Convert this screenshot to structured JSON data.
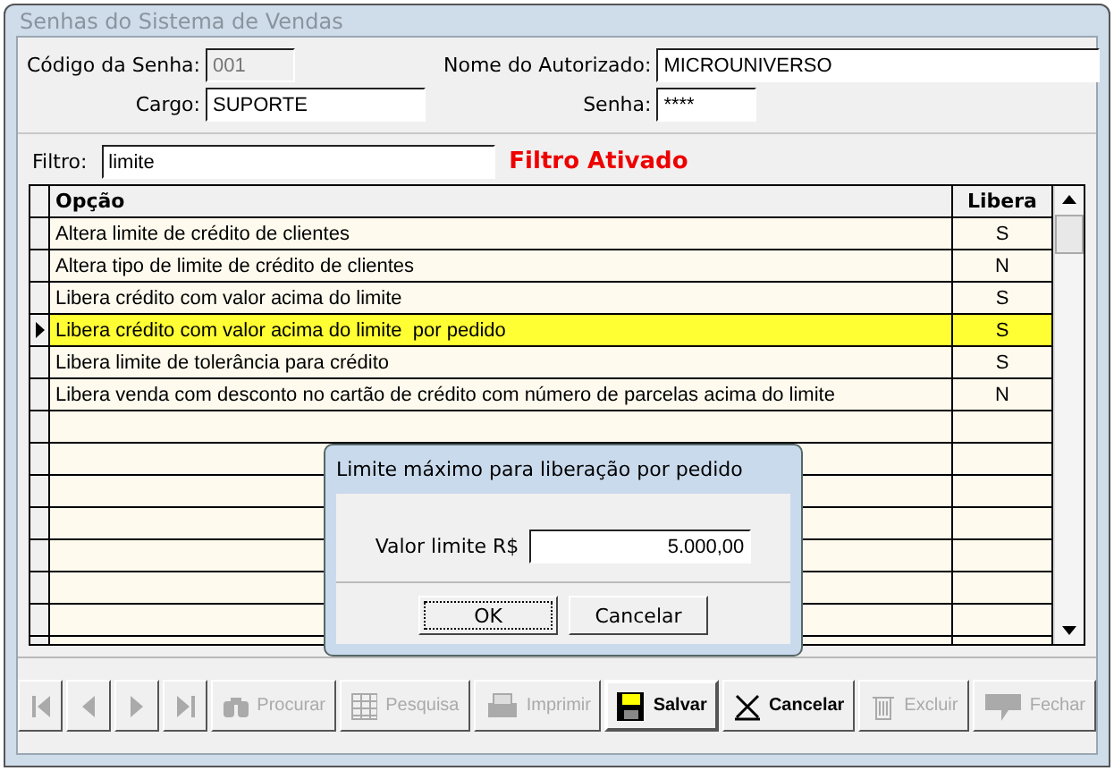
{
  "window": {
    "title": "Senhas do Sistema de Vendas"
  },
  "form": {
    "codigo": {
      "label": "Código da Senha:",
      "value": "001",
      "disabled": true
    },
    "nome": {
      "label": "Nome do Autorizado:",
      "value": "MICROUNIVERSO"
    },
    "cargo": {
      "label": "Cargo:",
      "value": "SUPORTE"
    },
    "senha": {
      "label": "Senha:",
      "value": "****"
    }
  },
  "filter": {
    "label": "Filtro:",
    "value": "limite",
    "status": "Filtro Ativado"
  },
  "table": {
    "columns": [
      "Opção",
      "Libera"
    ],
    "rows": [
      {
        "opcao": "Altera limite de crédito de clientes",
        "libera": "S",
        "selected": false
      },
      {
        "opcao": "Altera tipo de limite de crédito de clientes",
        "libera": "N",
        "selected": false
      },
      {
        "opcao": "Libera crédito com valor acima do limite",
        "libera": "S",
        "selected": false
      },
      {
        "opcao": "Libera crédito com valor acima do limite  por pedido",
        "libera": "S",
        "selected": true
      },
      {
        "opcao": "Libera limite de tolerância para crédito",
        "libera": "S",
        "selected": false
      },
      {
        "opcao": "Libera venda com desconto no cartão de crédito com número de parcelas acima do limite",
        "libera": "N",
        "selected": false
      }
    ]
  },
  "dialog": {
    "title": "Limite máximo para liberação por pedido",
    "label": "Valor limite R$",
    "value": "5.000,00",
    "buttons": [
      "OK",
      "Cancelar"
    ]
  },
  "toolbar": [
    {
      "kind": "first",
      "disabled": true
    },
    {
      "kind": "prev",
      "disabled": true
    },
    {
      "kind": "next",
      "disabled": true
    },
    {
      "kind": "last",
      "disabled": true
    },
    {
      "kind": "find",
      "label": "Procurar",
      "disabled": true
    },
    {
      "kind": "grid",
      "label": "Pesquisa",
      "disabled": true
    },
    {
      "kind": "print",
      "label": "Imprimir",
      "disabled": true
    },
    {
      "kind": "save",
      "label": "Salvar",
      "disabled": false
    },
    {
      "kind": "cancel",
      "label": "Cancelar",
      "disabled": false
    },
    {
      "kind": "delete",
      "label": "Excluir",
      "disabled": true
    },
    {
      "kind": "close",
      "label": "Fechar",
      "disabled": true
    }
  ]
}
